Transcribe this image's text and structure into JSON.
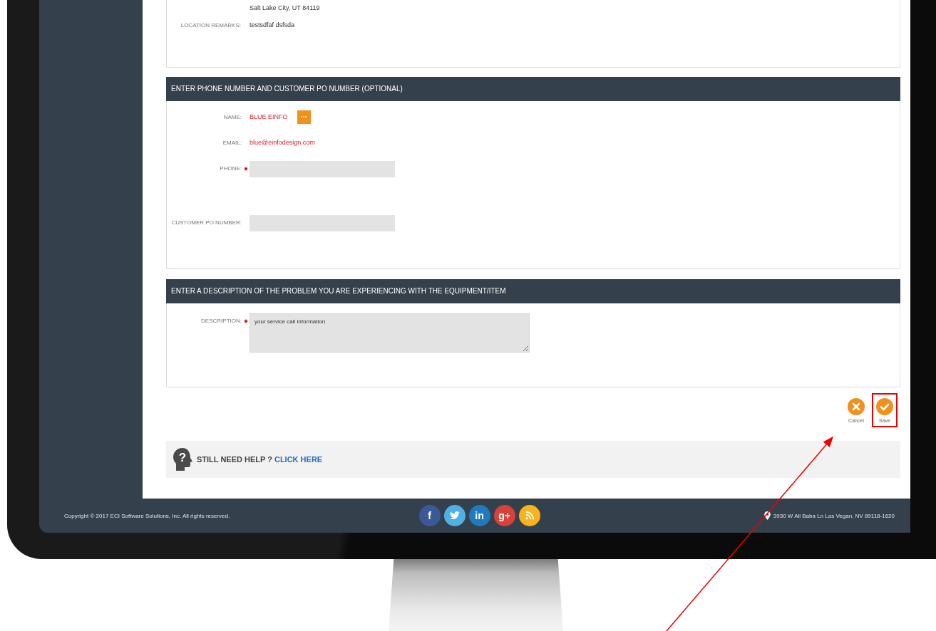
{
  "location": {
    "address": "Salt Lake City, UT 84119",
    "remarks_label": "LOCATION REMARKS:",
    "remarks": "testsdfaf dsfsda"
  },
  "contact": {
    "title": "ENTER PHONE NUMBER AND CUSTOMER PO NUMBER (OPTIONAL)",
    "fields": [
      {
        "kind": "text",
        "label": "NAME:",
        "value": "BLUE EINFO",
        "required": false,
        "more_button": true
      },
      {
        "kind": "text",
        "label": "EMAIL:",
        "value": "blue@einfodesign.com",
        "required": false,
        "more_button": false
      },
      {
        "kind": "input",
        "label": "PHONE:",
        "required": true
      },
      {
        "kind": "input",
        "label": "CUSTOMER PO NUMBER:",
        "required": false
      }
    ]
  },
  "problem": {
    "title": "ENTER A DESCRIPTION OF THE PROBLEM YOU ARE EXPERIENCING WITH THE EQUIPMENT/ITEM",
    "fields": [
      {
        "kind": "textarea",
        "label": "DESCRIPTION:",
        "required": true,
        "value": "your service call information"
      }
    ]
  },
  "actions": [
    {
      "kind": "cancel",
      "label": "Cancel",
      "highlighted": false
    },
    {
      "kind": "save",
      "label": "Save",
      "highlighted": true
    }
  ],
  "help": {
    "glyph": "?",
    "text": "STILL NEED HELP ?",
    "link": "CLICK HERE"
  },
  "footer": {
    "copyright": "Copyright © 2017 ECI Software Solutions, Inc. All rights reserved.",
    "social": [
      {
        "kind": "facebook",
        "label": "f",
        "color": "#3b5998"
      },
      {
        "kind": "twitter",
        "color": "#4fb0e6"
      },
      {
        "kind": "linkedin",
        "label": "in",
        "color": "#1e7bbf"
      },
      {
        "kind": "googleplus",
        "label": "g+",
        "color": "#d8413a"
      },
      {
        "kind": "rss",
        "color": "#f7b21c"
      }
    ],
    "address": "3930 W Ali Baba Ln Las Vegan, NV 89118-1620"
  }
}
